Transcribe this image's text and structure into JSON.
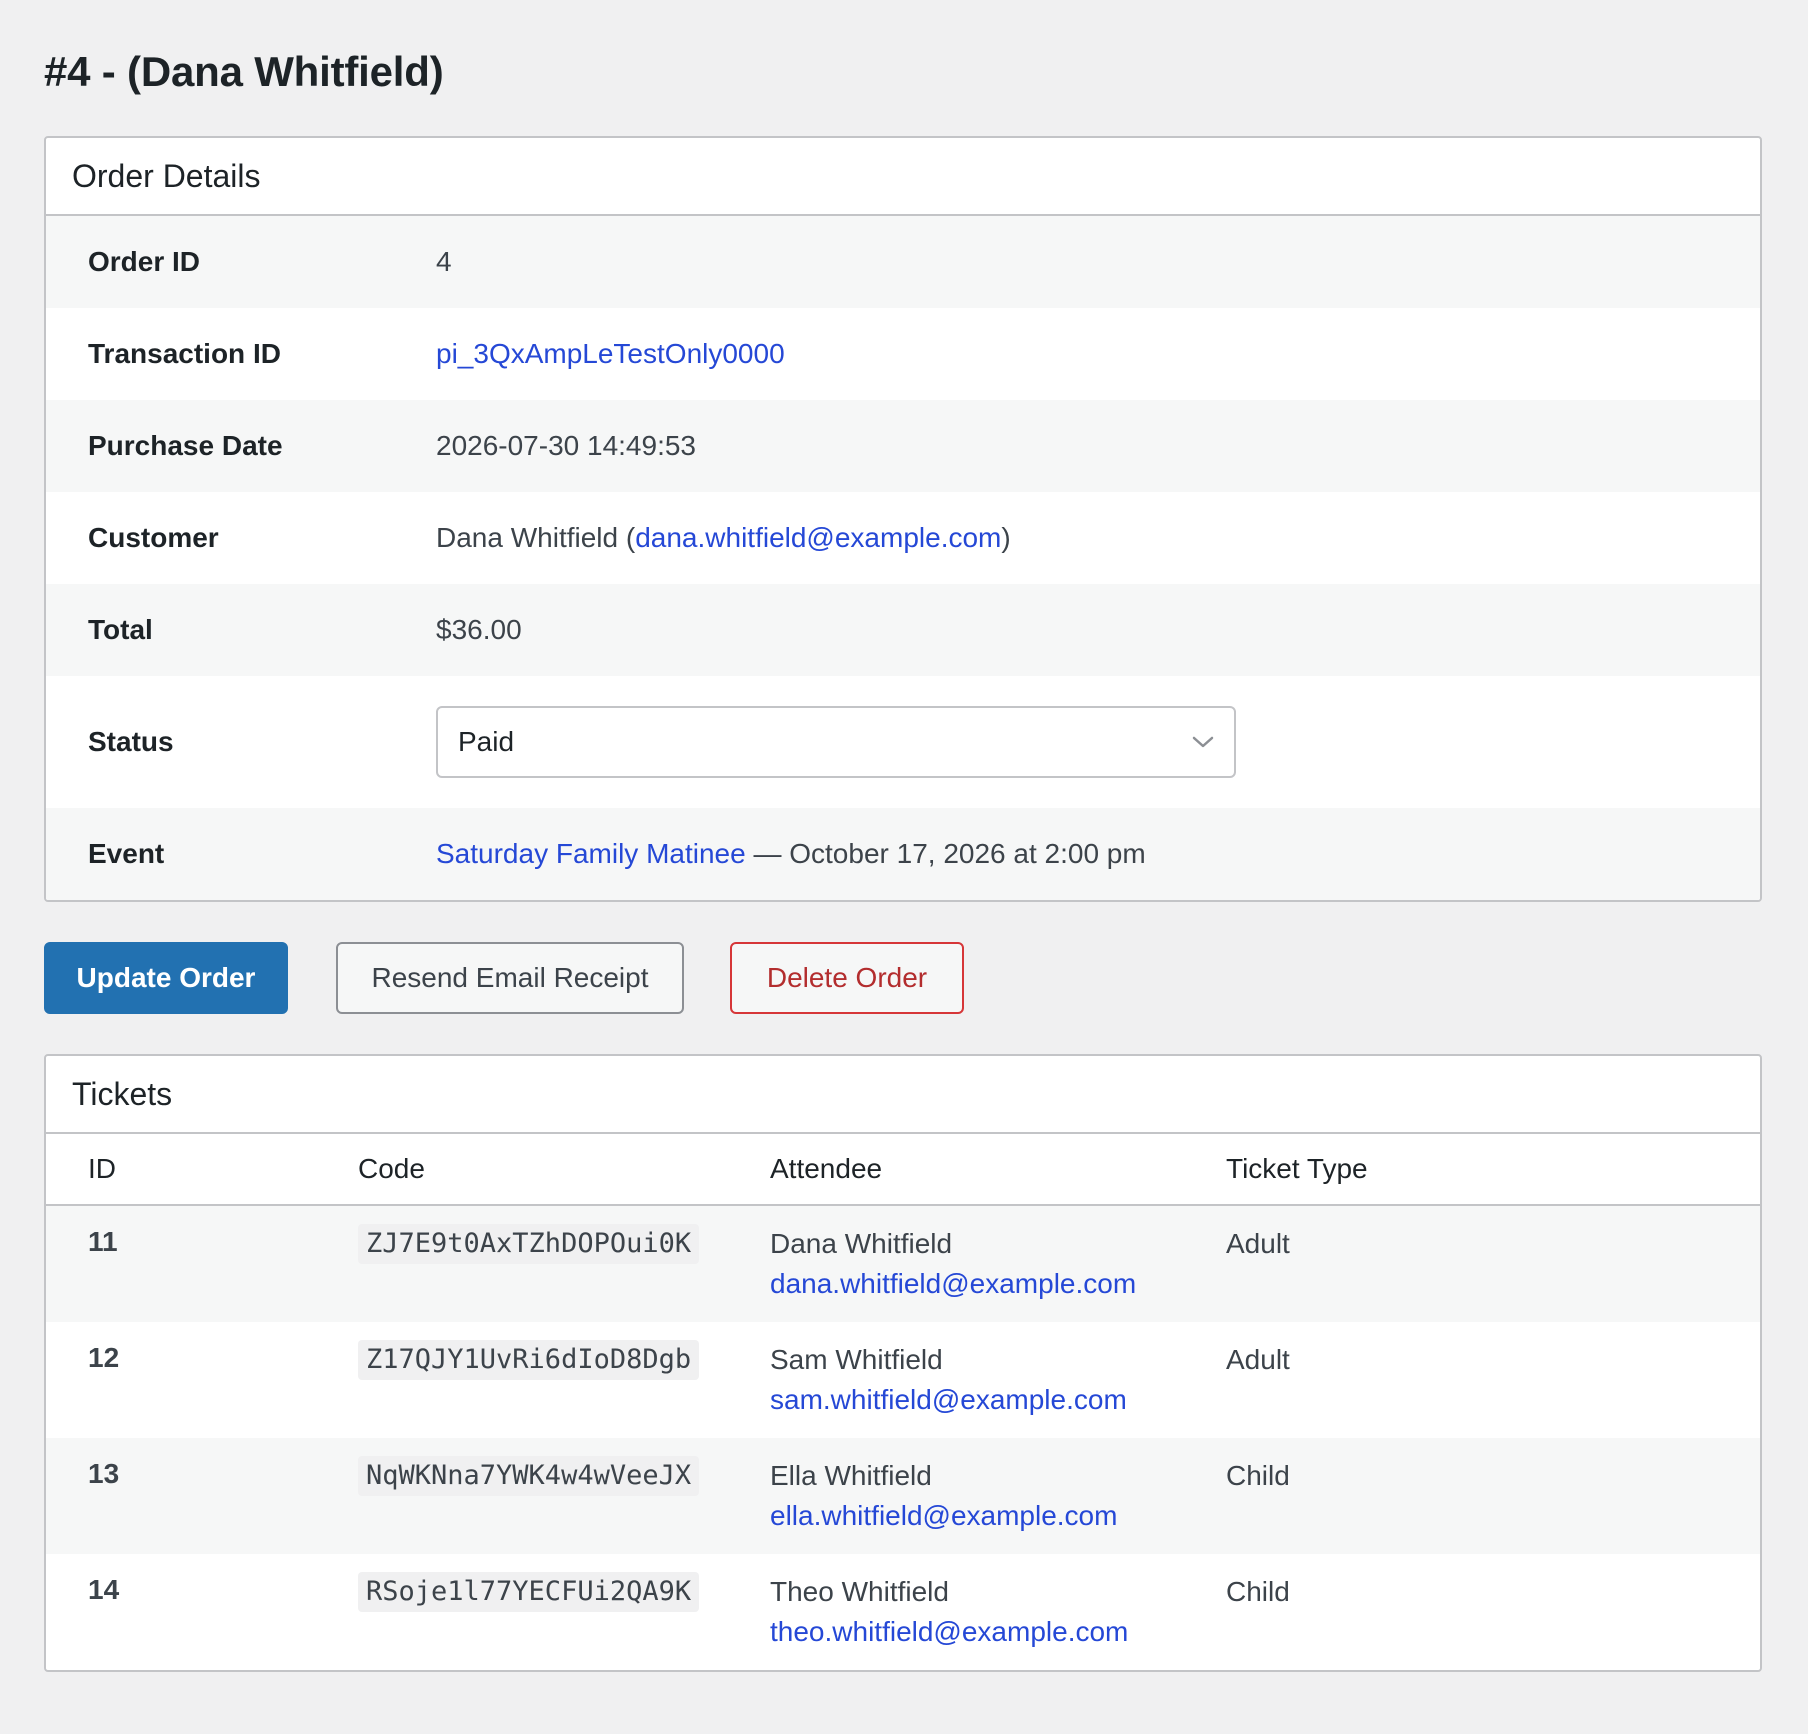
{
  "page": {
    "title": "#4 - (Dana Whitfield)"
  },
  "order_details": {
    "heading": "Order Details",
    "order_id": {
      "label": "Order ID",
      "value": "4"
    },
    "transaction_id": {
      "label": "Transaction ID",
      "value": "pi_3QxAmpLeTestOnly0000"
    },
    "purchase_date": {
      "label": "Purchase Date",
      "value": "2026-07-30 14:49:53"
    },
    "customer": {
      "label": "Customer",
      "name": "Dana Whitfield",
      "open_paren": " (",
      "email": "dana.whitfield@example.com",
      "close_paren": ")"
    },
    "total": {
      "label": "Total",
      "value": "$36.00"
    },
    "status": {
      "label": "Status",
      "selected": "Paid",
      "icon": "chevron-down-icon"
    },
    "event": {
      "label": "Event",
      "name": "Saturday Family Matinee",
      "when": " — October 17, 2026 at 2:00 pm"
    }
  },
  "actions": {
    "update": "Update Order",
    "resend": "Resend Email Receipt",
    "delete": "Delete Order"
  },
  "tickets": {
    "heading": "Tickets",
    "columns": [
      "ID",
      "Code",
      "Attendee",
      "Ticket Type"
    ],
    "rows": [
      {
        "id": "11",
        "code": "ZJ7E9t0AxTZhDOPOui0K",
        "name": "Dana Whitfield",
        "email": "dana.whitfield@example.com",
        "type": "Adult"
      },
      {
        "id": "12",
        "code": "Z17QJY1UvRi6dIoD8Dgb",
        "name": "Sam Whitfield",
        "email": "sam.whitfield@example.com",
        "type": "Adult"
      },
      {
        "id": "13",
        "code": "NqWKNna7YWK4w4wVeeJX",
        "name": "Ella Whitfield",
        "email": "ella.whitfield@example.com",
        "type": "Child"
      },
      {
        "id": "14",
        "code": "RSoje1l77YECFUi2QA9K",
        "name": "Theo Whitfield",
        "email": "theo.whitfield@example.com",
        "type": "Child"
      }
    ]
  },
  "colors": {
    "background": "#f0f0f1",
    "primary": "#2271b1",
    "link": "#2548d6",
    "danger": "#d63638"
  }
}
